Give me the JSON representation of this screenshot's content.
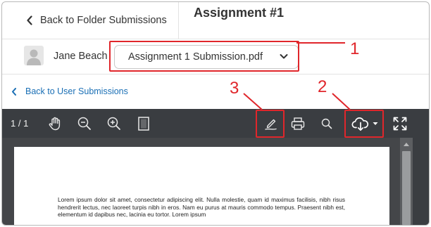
{
  "header": {
    "back_label": "Back to Folder Submissions",
    "title": "Assignment #1"
  },
  "student": {
    "name": "Jane Beach",
    "file_selected": "Assignment 1 Submission.pdf"
  },
  "nav": {
    "back_label": "Back to User Submissions"
  },
  "toolbar": {
    "page_count": "1 / 1",
    "icons": [
      "hand-pan-icon",
      "zoom-out-icon",
      "zoom-in-icon",
      "fit-page-icon",
      "annotate-pen-icon",
      "print-icon",
      "search-icon",
      "download-cloud-icon",
      "fullscreen-icon"
    ]
  },
  "document": {
    "text": "Lorem ipsum dolor sit amet, consectetur adipiscing elit. Nulla molestie, quam id maximus facilisis, nibh risus hendrerit lectus, nec laoreet turpis nibh in eros. Nam eu purus at mauris commodo tempus. Praesent nibh est, elementum id dapibus nec, lacinia eu tortor. Lorem ipsum"
  },
  "callouts": {
    "one": "1",
    "two": "2",
    "three": "3"
  },
  "colors": {
    "link": "#1a6fb5",
    "toolbar_bg": "#3a3d41",
    "callout": "#e0262b"
  }
}
